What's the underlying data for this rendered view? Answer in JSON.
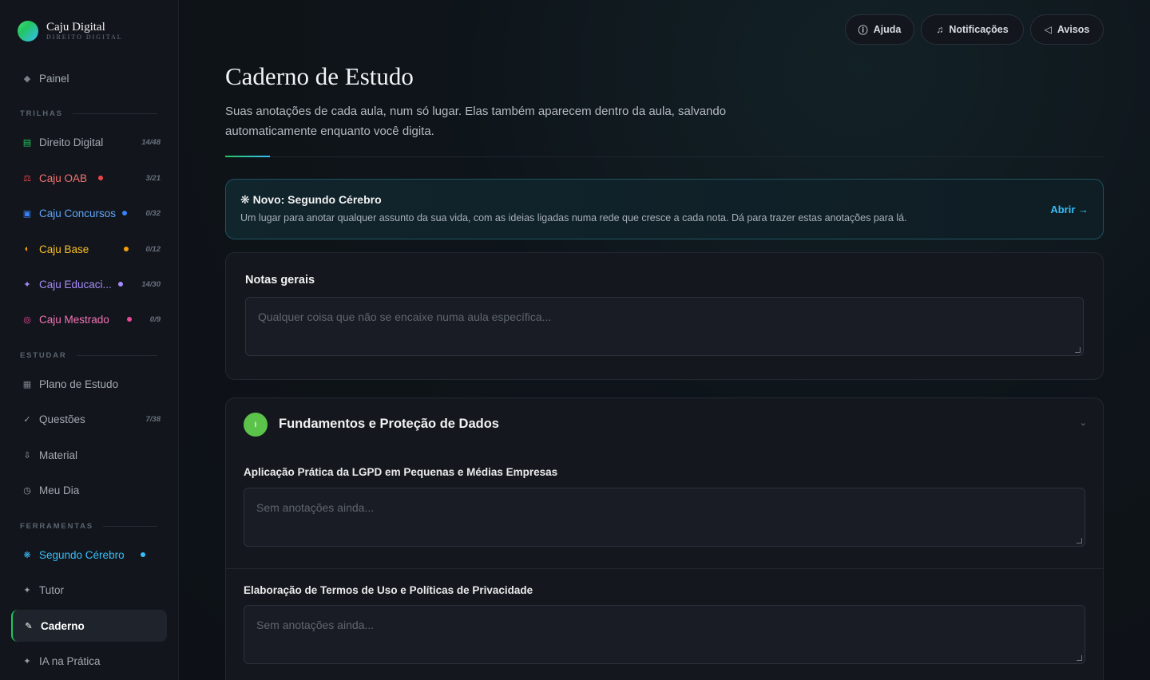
{
  "brand": {
    "name": "Caju Digital",
    "sub": "DIREITO DIGITAL"
  },
  "sidebar": {
    "panel": {
      "icon": "diamond-icon",
      "label": "Painel"
    },
    "sections": {
      "trilhas": "TRILHAS",
      "estudar": "ESTUDAR",
      "ferramentas": "FERRAMENTAS"
    },
    "trilhas": [
      {
        "icon": "book-icon",
        "icon_color": "#22c55e",
        "label": "Direito Digital",
        "count": "14/48",
        "label_color": "#a3a8b0",
        "dot": ""
      },
      {
        "icon": "scales-icon",
        "icon_color": "#ef4444",
        "label": "Caju OAB",
        "count": "3/21",
        "label_color": "#f87171",
        "dot": "#ef4444"
      },
      {
        "icon": "building-icon",
        "icon_color": "#3b82f6",
        "label": "Caju Concursos",
        "count": "0/32",
        "label_color": "#60a5fa",
        "dot": "#3b82f6"
      },
      {
        "icon": "half-circle-icon",
        "icon_color": "#f59e0b",
        "label": "Caju Base",
        "count": "0/12",
        "label_color": "#fbbf24",
        "dot": "#f59e0b"
      },
      {
        "icon": "sparkle-icon",
        "icon_color": "#a78bfa",
        "label": "Caju Educaci...",
        "count": "14/30",
        "label_color": "#a78bfa",
        "dot": "#a78bfa"
      },
      {
        "icon": "target-icon",
        "icon_color": "#ec4899",
        "label": "Caju Mestrado",
        "count": "0/9",
        "label_color": "#f472b6",
        "dot": "#ec4899"
      }
    ],
    "estudar": [
      {
        "icon": "calendar-icon",
        "label": "Plano de Estudo",
        "count": ""
      },
      {
        "icon": "check-icon",
        "label": "Questões",
        "count": "7/38"
      },
      {
        "icon": "download-icon",
        "label": "Material",
        "count": ""
      },
      {
        "icon": "clock-icon",
        "label": "Meu Dia",
        "count": ""
      }
    ],
    "ferramentas": [
      {
        "icon": "snowflake-icon",
        "label": "Segundo Cérebro",
        "label_color": "#38bdf8",
        "dot": "#38bdf8"
      },
      {
        "icon": "star-icon",
        "label": "Tutor"
      },
      {
        "icon": "pen-icon",
        "label": "Caderno",
        "active": true
      },
      {
        "icon": "star-icon",
        "label": "IA na Prática"
      }
    ]
  },
  "topbar": {
    "help": "Ajuda",
    "notifications": "Notificações",
    "notices": "Avisos"
  },
  "page": {
    "title": "Caderno de Estudo",
    "subtitle": "Suas anotações de cada aula, num só lugar. Elas também aparecem dentro da aula, salvando automaticamente enquanto você digita."
  },
  "banner": {
    "title": "❋ Novo: Segundo Cérebro",
    "text": "Um lugar para anotar qualquer assunto da sua vida, com as ideias ligadas numa rede que cresce a cada nota. Dá para trazer estas anotações para lá.",
    "link": "Abrir →"
  },
  "general_notes": {
    "heading": "Notas gerais",
    "placeholder": "Qualquer coisa que não se encaixe numa aula específica..."
  },
  "module": {
    "badge": "I",
    "title": "Fundamentos e Proteção de Dados",
    "lessons": [
      {
        "title": "Aplicação Prática da LGPD em Pequenas e Médias Empresas",
        "placeholder": "Sem anotações ainda..."
      },
      {
        "title": "Elaboração de Termos de Uso e Políticas de Privacidade",
        "placeholder": "Sem anotações ainda..."
      }
    ]
  },
  "colors": {
    "accent_green": "#22c55e",
    "accent_blue": "#38bdf8",
    "background": "#0d1117"
  }
}
